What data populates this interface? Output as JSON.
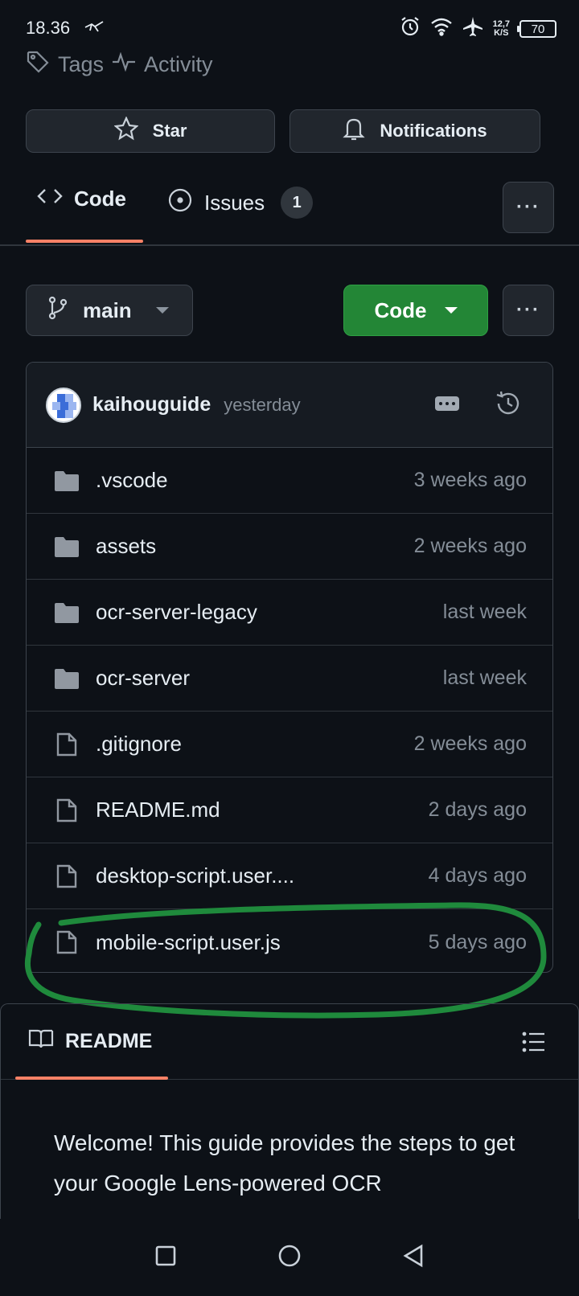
{
  "status_bar": {
    "time": "18.36",
    "speed_value": "12,7",
    "speed_unit": "K/S",
    "battery": "70"
  },
  "repo_nav": {
    "tags_label": "Tags",
    "activity_label": "Activity"
  },
  "actions": {
    "star_label": "Star",
    "notifications_label": "Notifications"
  },
  "tabs": [
    {
      "label": "Code",
      "selected": true
    },
    {
      "label": "Issues",
      "count": "1"
    }
  ],
  "branch": {
    "name": "main",
    "code_button_label": "Code"
  },
  "commit": {
    "author": "kaihouguide",
    "time": "yesterday"
  },
  "files": [
    {
      "name": ".vscode",
      "type": "folder",
      "time": "3 weeks ago"
    },
    {
      "name": "assets",
      "type": "folder",
      "time": "2 weeks ago"
    },
    {
      "name": "ocr-server-legacy",
      "type": "folder",
      "time": "last week"
    },
    {
      "name": "ocr-server",
      "type": "folder",
      "time": "last week"
    },
    {
      "name": ".gitignore",
      "type": "file",
      "time": "2 weeks ago"
    },
    {
      "name": "README.md",
      "type": "file",
      "time": "2 days ago"
    },
    {
      "name": "desktop-script.user....",
      "type": "file",
      "time": "4 days ago"
    },
    {
      "name": "mobile-script.user.js",
      "type": "file",
      "time": "5 days ago"
    }
  ],
  "readme": {
    "title": "README",
    "body": "Welcome! This guide provides the steps to get your Google Lens-powered OCR"
  },
  "colors": {
    "background": "#0d1117",
    "accent_underline": "#f78166",
    "code_button": "#238636",
    "annotation": "#1f8a3c"
  }
}
